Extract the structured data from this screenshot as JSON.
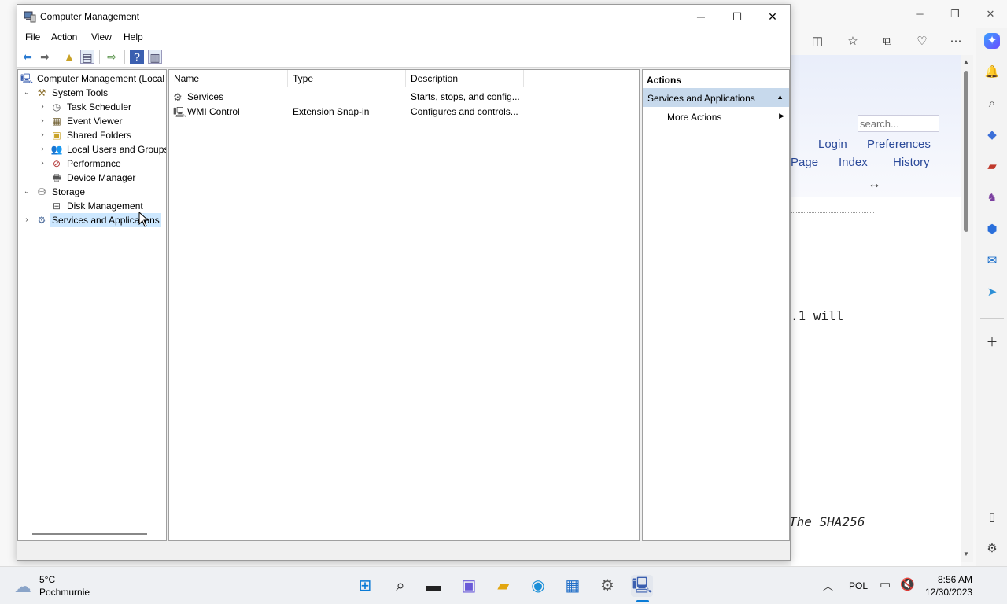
{
  "browser": {
    "search_placeholder": "search...",
    "links": {
      "login": "Login",
      "preferences": "Preferences",
      "page": "Page",
      "index": "Index",
      "history": "History"
    },
    "arrow": "↔",
    "text_fragment1": ".1 will",
    "text_fragment2": "The SHA256"
  },
  "window": {
    "title": "Computer Management",
    "menu": [
      "File",
      "Action",
      "View",
      "Help"
    ],
    "tree": {
      "root": "Computer Management (Local",
      "system_tools": "System Tools",
      "task_scheduler": "Task Scheduler",
      "event_viewer": "Event Viewer",
      "shared_folders": "Shared Folders",
      "local_users": "Local Users and Groups",
      "performance": "Performance",
      "device_manager": "Device Manager",
      "storage": "Storage",
      "disk_management": "Disk Management",
      "services_apps": "Services and Applications"
    },
    "list": {
      "columns": {
        "name": "Name",
        "type": "Type",
        "description": "Description"
      },
      "rows": [
        {
          "name": "Services",
          "type": "",
          "description": "Starts, stops, and config..."
        },
        {
          "name": "WMI Control",
          "type": "Extension Snap-in",
          "description": "Configures and controls..."
        }
      ]
    },
    "actions": {
      "header": "Actions",
      "section": "Services and Applications",
      "more": "More Actions"
    }
  },
  "taskbar": {
    "weather_temp": "5°C",
    "weather_desc": "Pochmurnie",
    "language": "POL",
    "time": "8:56 AM",
    "date": "12/30/2023"
  }
}
